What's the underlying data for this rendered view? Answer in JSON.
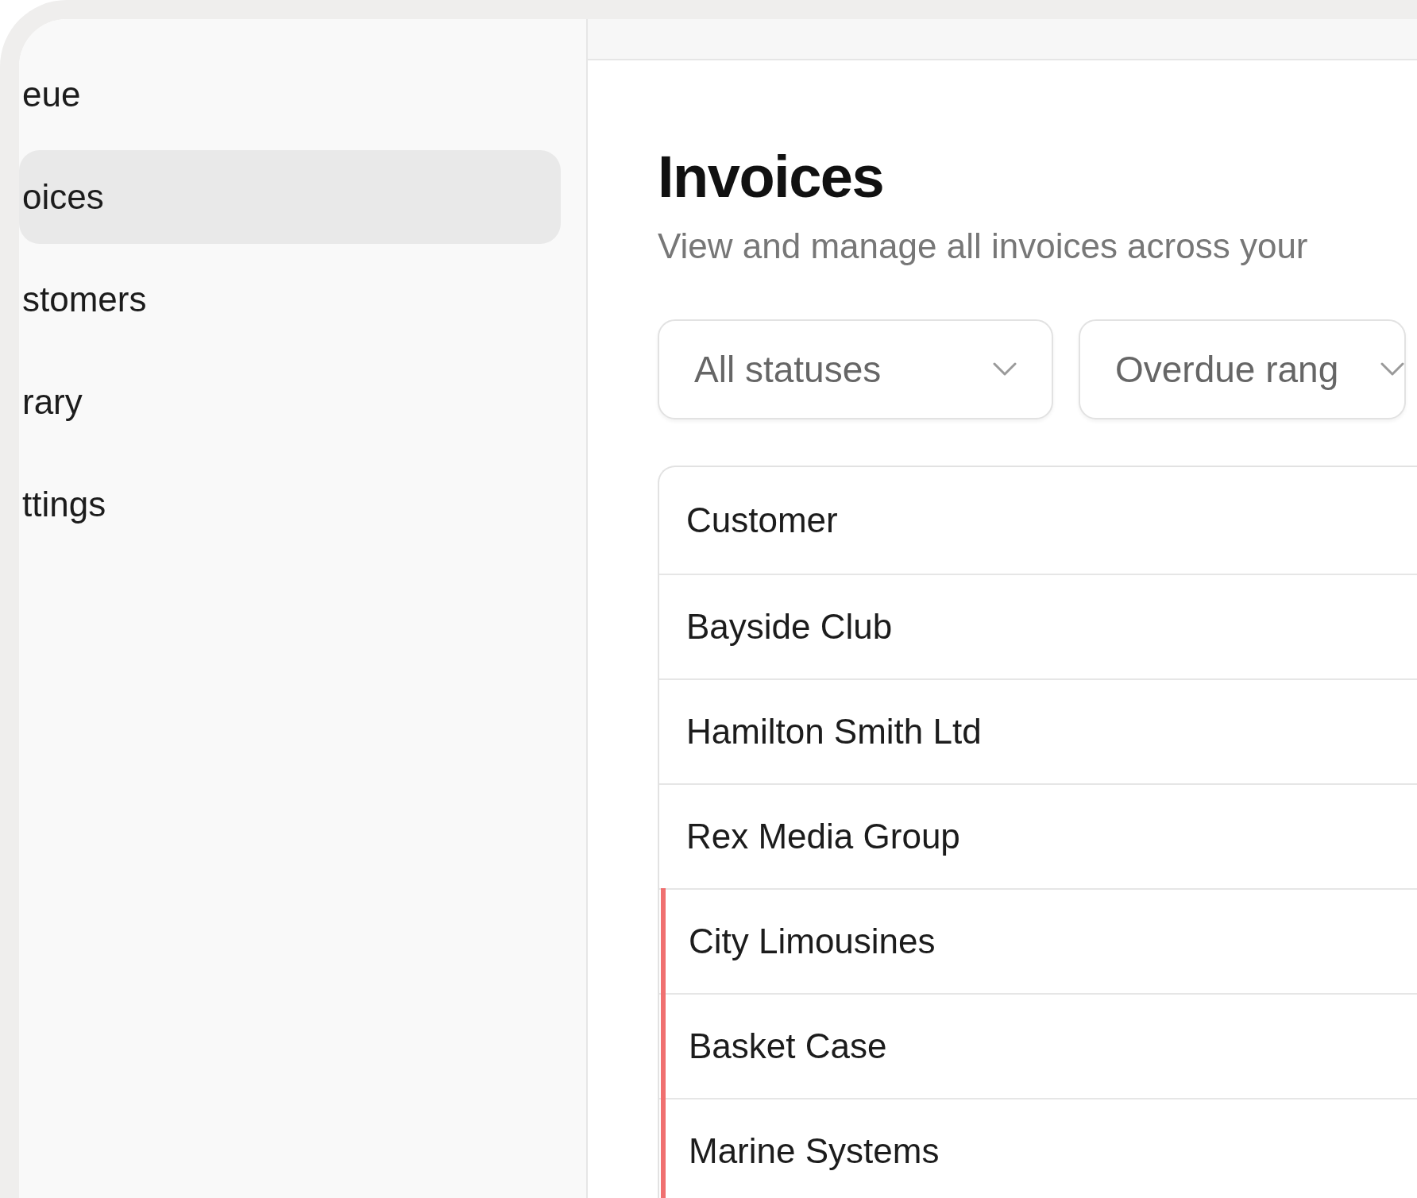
{
  "sidebar": {
    "items": [
      {
        "label": "eue",
        "selected": false
      },
      {
        "label": "oices",
        "selected": true
      },
      {
        "label": "stomers",
        "selected": false
      },
      {
        "label": "rary",
        "selected": false
      },
      {
        "label": "ttings",
        "selected": false
      }
    ]
  },
  "page": {
    "title": "Invoices",
    "subtitle": "View and manage all invoices across your"
  },
  "filters": [
    {
      "value": "All statuses"
    },
    {
      "value": "Overdue rang"
    }
  ],
  "table": {
    "columns": [
      "Customer"
    ],
    "rows": [
      {
        "customer": "Bayside Club",
        "flagged": false
      },
      {
        "customer": "Hamilton Smith Ltd",
        "flagged": false
      },
      {
        "customer": "Rex Media Group",
        "flagged": false
      },
      {
        "customer": "City Limousines",
        "flagged": true
      },
      {
        "customer": "Basket Case",
        "flagged": true
      },
      {
        "customer": "Marine Systems",
        "flagged": true
      }
    ]
  }
}
